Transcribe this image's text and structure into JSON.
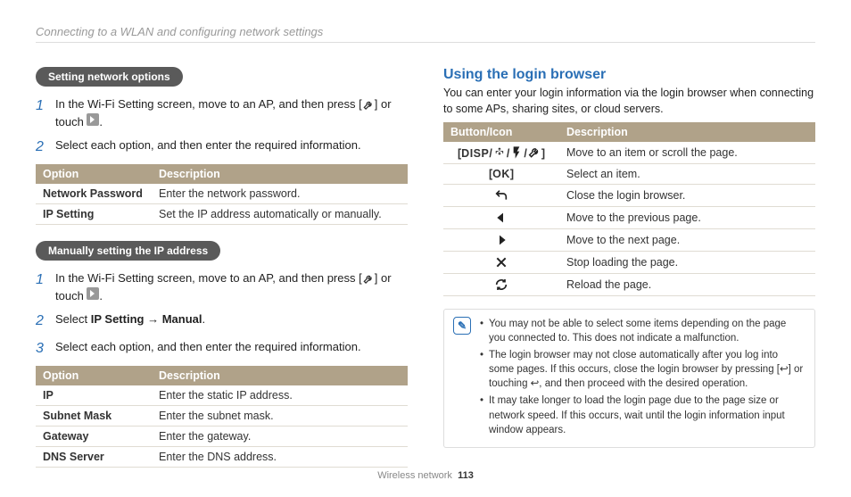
{
  "header": {
    "title": "Connecting to a WLAN and configuring network settings"
  },
  "footer": {
    "section": "Wireless network",
    "page": "113"
  },
  "left": {
    "pill1": "Setting network options",
    "step1_1a": "In the Wi-Fi Setting screen, move to an AP, and then press ",
    "step1_1b": "[",
    "step1_1c": "] or touch ",
    "step1_1d": ".",
    "step1_2": "Select each option, and then enter the required information.",
    "table1": {
      "h1": "Option",
      "h2": "Description",
      "rows": [
        {
          "a": "Network Password",
          "b": "Enter the network password."
        },
        {
          "a": "IP Setting",
          "b": "Set the IP address automatically or manually."
        }
      ]
    },
    "pill2": "Manually setting the IP address",
    "step2_1a": "In the Wi-Fi Setting screen, move to an AP, and then press ",
    "step2_1b": "[",
    "step2_1c": "] or touch ",
    "step2_1d": ".",
    "step2_2a": "Select ",
    "step2_2b": "IP Setting",
    "step2_2c": " → ",
    "step2_2d": "Manual",
    "step2_2e": ".",
    "step2_3": "Select each option, and then enter the required information.",
    "table2": {
      "h1": "Option",
      "h2": "Description",
      "rows": [
        {
          "a": "IP",
          "b": "Enter the static IP address."
        },
        {
          "a": "Subnet Mask",
          "b": "Enter the subnet mask."
        },
        {
          "a": "Gateway",
          "b": "Enter the gateway."
        },
        {
          "a": "DNS Server",
          "b": "Enter the DNS address."
        }
      ]
    }
  },
  "right": {
    "heading": "Using the login browser",
    "intro": "You can enter your login information via the login browser when connecting to some APs, sharing sites, or cloud servers.",
    "table": {
      "h1": "Button/Icon",
      "h2": "Description",
      "rows": [
        {
          "icon": "disp",
          "b": "Move to an item or scroll the page."
        },
        {
          "icon": "ok",
          "b": "Select an item."
        },
        {
          "icon": "back",
          "b": "Close the login browser."
        },
        {
          "icon": "left",
          "b": "Move to the previous page."
        },
        {
          "icon": "right",
          "b": "Move to the next page."
        },
        {
          "icon": "close",
          "b": "Stop loading the page."
        },
        {
          "icon": "reload",
          "b": "Reload the page."
        }
      ]
    },
    "notes": [
      "You may not be able to select some items depending on the page you connected to. This does not indicate a malfunction.",
      "The login browser may not close automatically after you log into some pages. If this occurs, close the login browser by pressing [↩] or touching ↩, and then proceed with the desired operation.",
      "It may take longer to load the login page due to the page size or network speed. If this occurs, wait until the login information input window appears."
    ]
  }
}
